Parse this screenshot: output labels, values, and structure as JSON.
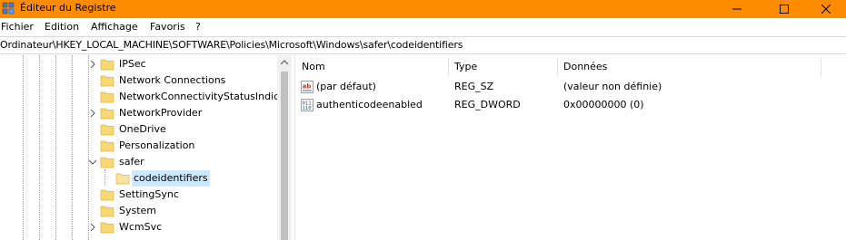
{
  "window": {
    "title": "Éditeur du Registre",
    "icon": "regedit-icon"
  },
  "menu": {
    "items": [
      "Fichier",
      "Edition",
      "Affichage",
      "Favoris",
      "?"
    ]
  },
  "address": {
    "path": "Ordinateur\\HKEY_LOCAL_MACHINE\\SOFTWARE\\Policies\\Microsoft\\Windows\\safer\\codeidentifiers"
  },
  "tree": {
    "items": [
      {
        "label": "IPSec",
        "expander": "collapsed"
      },
      {
        "label": "Network Connections",
        "expander": "none"
      },
      {
        "label": "NetworkConnectivityStatusIndic",
        "expander": "none"
      },
      {
        "label": "NetworkProvider",
        "expander": "collapsed"
      },
      {
        "label": "OneDrive",
        "expander": "none"
      },
      {
        "label": "Personalization",
        "expander": "none"
      },
      {
        "label": "safer",
        "expander": "expanded"
      },
      {
        "label": "codeidentifiers",
        "expander": "none",
        "selected": true
      },
      {
        "label": "SettingSync",
        "expander": "none"
      },
      {
        "label": "System",
        "expander": "none"
      },
      {
        "label": "WcmSvc",
        "expander": "collapsed"
      }
    ]
  },
  "list": {
    "columns": [
      "Nom",
      "Type",
      "Données"
    ],
    "rows": [
      {
        "icon": "string-value-icon",
        "name": "(par défaut)",
        "type": "REG_SZ",
        "data": "(valeur non définie)"
      },
      {
        "icon": "dword-value-icon",
        "name": "authenticodeenabled",
        "type": "REG_DWORD",
        "data": "0x00000000 (0)"
      }
    ]
  },
  "colors": {
    "titlebar": "#ff8c00",
    "selection": "#cce8ff",
    "folder": "#f8d775"
  }
}
